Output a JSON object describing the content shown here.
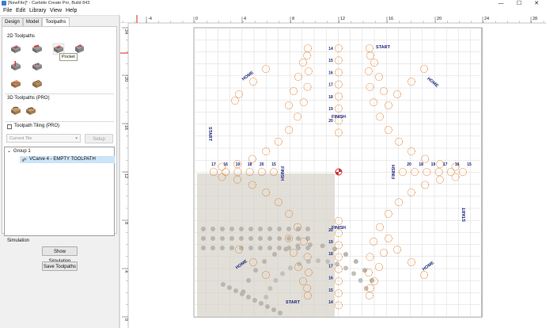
{
  "window": {
    "title": "[NewFile]* - Carbide Create Pro, Build 843",
    "min": "—",
    "max": "☐",
    "close": "✕"
  },
  "menu": [
    "File",
    "Edit",
    "Library",
    "View",
    "Help"
  ],
  "tabs": [
    "Design",
    "Model",
    "Toolpaths"
  ],
  "active_tab": "Toolpaths",
  "panel": {
    "section_2d": "2D Toolpaths",
    "section_3d": "3D Toolpaths (PRO)",
    "tooltip": "Pocket",
    "tiling_label": "Toolpath Tiling (PRO)",
    "tile_select": "Current Tile",
    "setup_button": "Setup",
    "tree_group": "Group 1",
    "tree_item": "VCarve 4 - EMPTY TOOLPATH",
    "simulation_label": "Simulation",
    "show_sim_button": "Show Simulation",
    "save_button": "Save Toolpaths"
  },
  "icons_2d": [
    "contour-icon",
    "drill-icon",
    "pocket-icon",
    "vcarve-icon",
    "advanced-vcarve-icon",
    "texture-icon",
    "rough-icon",
    "finish-icon"
  ],
  "icons_3d": [
    "3d-rough-icon",
    "3d-finish-icon"
  ],
  "ruler": {
    "x_ticks": [
      "-4",
      "0",
      "4",
      "8",
      "12",
      "16",
      "20",
      "24",
      "28"
    ],
    "y_ticks": [
      "24",
      "20",
      "16",
      "12",
      "8",
      "4",
      "0"
    ]
  },
  "board": {
    "labels": {
      "start": "START",
      "finish": "FINISH",
      "home": "HOME"
    },
    "numbers_top_center": [
      "14",
      "15",
      "16",
      "17",
      "18",
      "19",
      "20"
    ],
    "numbers_left_row": [
      "17",
      "16",
      "19",
      "18",
      "20",
      "15"
    ],
    "numbers_right_row": [
      "20",
      "18",
      "19",
      "17",
      "16",
      "15"
    ],
    "numbers_bottom": [
      "14",
      "15",
      "16",
      "17",
      "18",
      "19",
      "20"
    ]
  },
  "colors": {
    "hole_stroke": "#e07b28",
    "text_navy": "#1a237e",
    "grid": "#d8d8d8",
    "sim_overlay": "#d4d2c8",
    "selection": "#cce4f7"
  }
}
